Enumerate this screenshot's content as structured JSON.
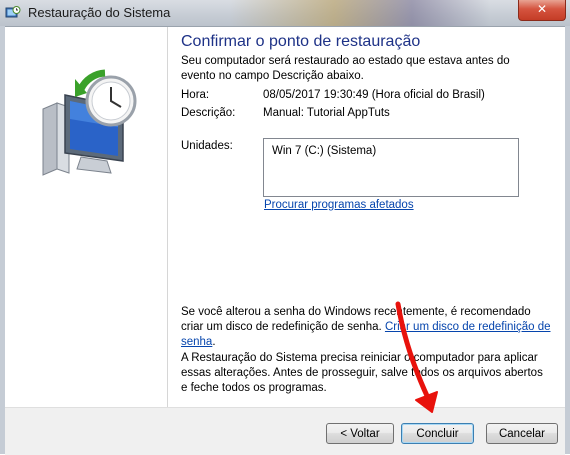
{
  "window": {
    "title": "Restauração do Sistema",
    "close_label": "✕"
  },
  "main": {
    "heading": "Confirmar o ponto de restauração",
    "intro": "Seu computador será restaurado ao estado que estava antes do evento no campo Descrição abaixo.",
    "time_label": "Hora:",
    "time_value": "08/05/2017 19:30:49 (Hora oficial do Brasil)",
    "description_label": "Descrição:",
    "description_value": "Manual: Tutorial AppTuts",
    "drives_label": "Unidades:",
    "drives": [
      "Win 7 (C:) (Sistema)"
    ],
    "scan_link": "Procurar programas afetados",
    "password_text": "Se você alterou a senha do Windows recentemente, é recomendado criar um disco de redefinição de senha.",
    "password_link": "Criar um disco de redefinição de senha",
    "restart_text": "A Restauração do Sistema precisa reiniciar o computador para aplicar essas alterações. Antes de prosseguir, salve todos os arquivos abertos e feche todos os programas."
  },
  "buttons": {
    "back": "< Voltar",
    "finish": "Concluir",
    "cancel": "Cancelar"
  },
  "colors": {
    "heading": "#1e3287",
    "link": "#0645ad",
    "annotation_arrow": "#e8120c"
  }
}
